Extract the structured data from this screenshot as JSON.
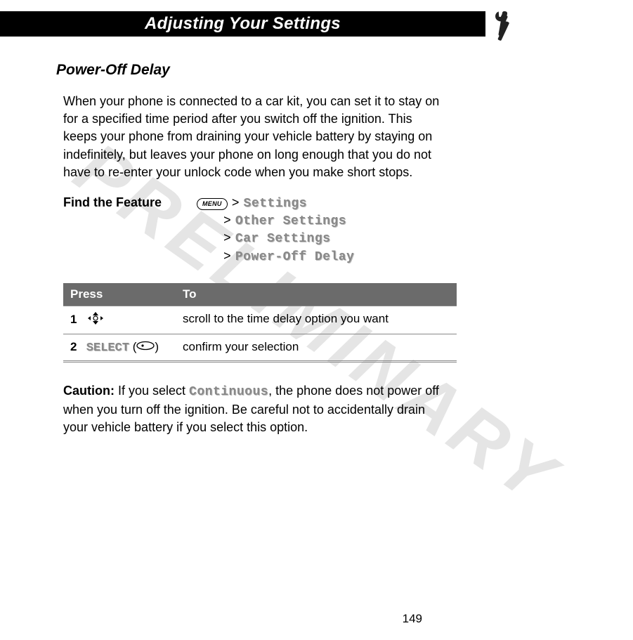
{
  "watermark": "PRELIMINARY",
  "header": {
    "title": "Adjusting Your Settings"
  },
  "section": {
    "title": "Power-Off Delay",
    "intro": "When your phone is connected to a car kit, you can set it to stay on for a specified time period after you switch off the ignition. This keeps your phone from draining your vehicle battery by staying on indefinitely, but leaves your phone on long enough that you do not have to re-enter your unlock code when you make short stops."
  },
  "feature": {
    "label": "Find the Feature",
    "menu_key": "MENU",
    "gt": ">",
    "path": {
      "item0": "Settings",
      "item1": "Other Settings",
      "item2": "Car Settings",
      "item3": "Power-Off Delay"
    }
  },
  "table": {
    "col1": "Press",
    "col2": "To",
    "rows": {
      "r1": {
        "num": "1",
        "to": "scroll to the time delay option you want"
      },
      "r2": {
        "num": "2",
        "press_label": "SELECT",
        "to": "confirm your selection"
      }
    }
  },
  "caution": {
    "label": "Caution:",
    "text_before": " If you select ",
    "continuous": "Continuous",
    "text_after": ", the phone does not power off when you turn off the ignition. Be careful not to accidentally drain your vehicle battery if you select this option."
  },
  "page_number": "149"
}
